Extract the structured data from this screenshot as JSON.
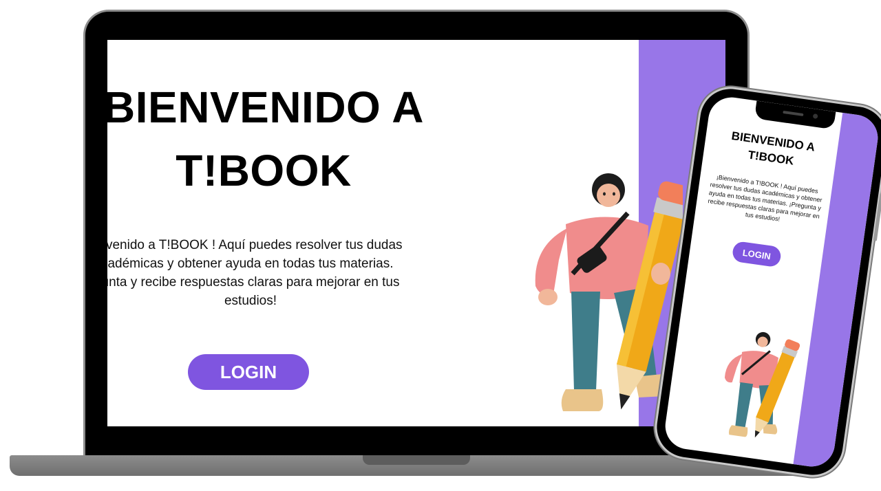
{
  "desktop": {
    "title_line1": "BIENVENIDO A",
    "title_line2": "T!BOOK",
    "description_line1": "nvenido a T!BOOK ! Aquí puedes resolver tus dudas",
    "description_line2": "adémicas y obtener ayuda en todas tus materias.",
    "description_line3": "unta y recibe respuestas claras para mejorar en tus",
    "description_line4": "estudios!",
    "login_label": "LOGIN"
  },
  "mobile": {
    "title_line1": "BIENVENIDO A",
    "title_line2": "T!BOOK",
    "description": "¡Bienvenido a T!BOOK ! Aquí puedes resolver tus dudas académicas y obtener ayuda en todas tus materias. ¡Pregunta y recibe respuestas claras para mejorar en tus estudios!",
    "login_label": "LOGIN"
  },
  "colors": {
    "accent_purple": "#9876e8",
    "button_purple": "#7f55e0",
    "bezel": "#000000"
  },
  "illustration": "3d-person-with-giant-pencil"
}
